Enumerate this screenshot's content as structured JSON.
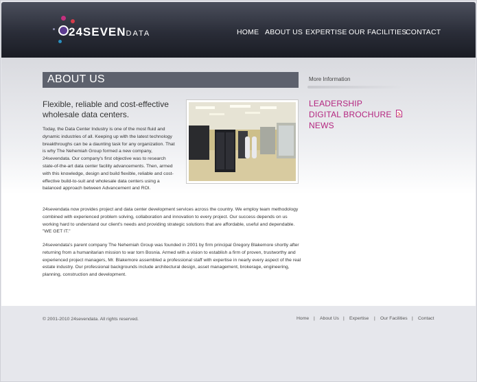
{
  "brand": {
    "logo_text_primary": "24SEVEN",
    "logo_text_secondary": "DATA",
    "colors": {
      "header_dark": "#22252f",
      "accent_magenta": "#b4257f",
      "title_bar": "#5d616d"
    }
  },
  "nav": {
    "items": [
      "HOME",
      "ABOUT US",
      "EXPERTISE",
      "OUR FACILITIES",
      "CONTACT"
    ]
  },
  "main": {
    "page_title": "ABOUT US",
    "tagline": "Flexible, reliable and cost-effective wholesale data centers.",
    "paragraph_1": "Today, the Data Center Industry is one of the most fluid and dynamic industries of all. Keeping up with the latest technology breakthroughs can be a daunting task for any organization. That is why The Nehemiah Group formed a new company, 24sevendata. Our company's first objective was to research state-of-the-art data center facility advancements. Then, armed with this knowledge, design and build flexible, reliable and cost-effective build-to-suit and wholesale data centers using a balanced approach between Advancement and ROI.",
    "paragraph_2": "24sevendata now provides project and data center development services across the country. We employ team methodology combined with experienced problem solving, collaboration and innovation to every project. Our success depends on us working hard to understand our client's needs and providing strategic solutions that are affordable, useful and dependable. \"WE GET IT.\"",
    "paragraph_3": "24sevendata's parent company The Nehemiah Group was founded in 2001 by firm principal Gregory Blakemore shortly after returning from a humanitarian mission to war torn Bosnia. Armed with a vision to establish a firm of proven, trustworthy and experienced project managers, Mr. Blakemore assembled a professional staff with expertise in nearly every aspect of the real estate industry. Our professional backgrounds include architectural design, asset management, brokerage, engineering, planning, construction and development."
  },
  "sidebar": {
    "heading": "More Information",
    "links": [
      "LEADERSHIP",
      "DIGITAL BROCHURE",
      "NEWS"
    ]
  },
  "footer": {
    "copyright": "© 2001-2010 24sevendata. All rights reserved.",
    "links": [
      "Home",
      "About Us",
      "Expertise",
      "Our Facilities",
      "Contact"
    ],
    "separator": "|"
  }
}
